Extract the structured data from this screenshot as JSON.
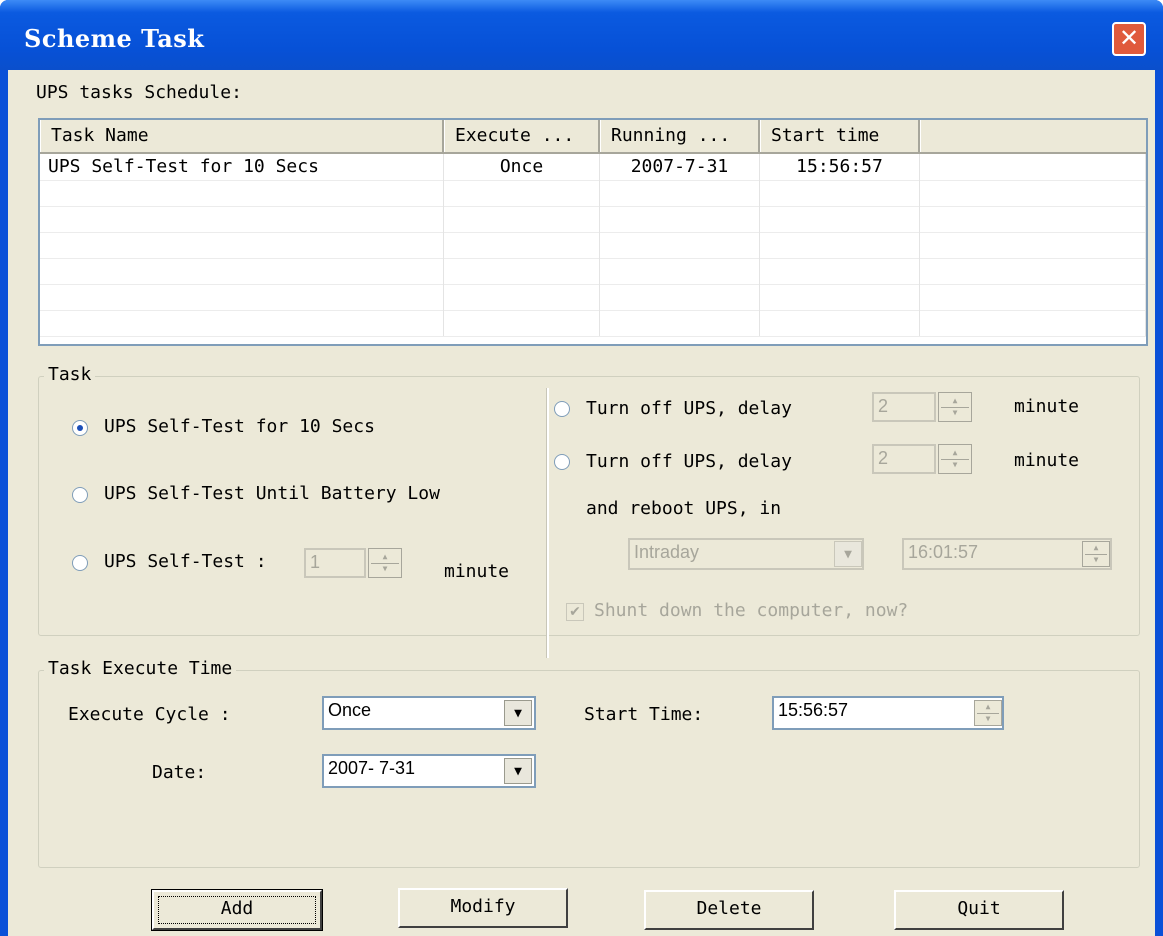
{
  "window": {
    "title": "Scheme Task",
    "close_label": "✕"
  },
  "schedule": {
    "label": "UPS tasks Schedule:",
    "columns": [
      "Task Name",
      "Execute ...",
      "Running ...",
      "Start time",
      ""
    ],
    "rows": [
      [
        "UPS Self-Test for 10 Secs",
        "Once",
        "2007-7-31",
        "15:56:57",
        ""
      ]
    ]
  },
  "task": {
    "legend": "Task",
    "self_test_10": {
      "label": "UPS Self-Test for 10 Secs",
      "selected": true
    },
    "self_test_battery": {
      "label": "UPS Self-Test Until Battery Low",
      "selected": false
    },
    "self_test_minutes": {
      "label": "UPS Self-Test :",
      "value": "1",
      "unit": "minute",
      "selected": false
    },
    "turn_off": {
      "label": "Turn off UPS, delay",
      "value": "2",
      "unit": "minute",
      "selected": false
    },
    "turn_off_reboot": {
      "label": "Turn off UPS, delay",
      "value": "2",
      "unit": "minute",
      "reboot_label": "and reboot UPS, in",
      "selected": false
    },
    "reboot_mode": "Intraday",
    "reboot_time": "16:01:57",
    "shutdown_label": "Shunt down the computer, now?",
    "shutdown_checked": true
  },
  "execute_time": {
    "legend": "Task Execute Time",
    "cycle_label": "Execute Cycle :",
    "cycle_value": "Once",
    "start_label": "Start Time:",
    "start_value": "15:56:57",
    "date_label": "Date:",
    "date_value": "2007- 7-31"
  },
  "buttons": {
    "add": "Add",
    "modify": "Modify",
    "delete": "Delete",
    "quit": "Quit"
  }
}
